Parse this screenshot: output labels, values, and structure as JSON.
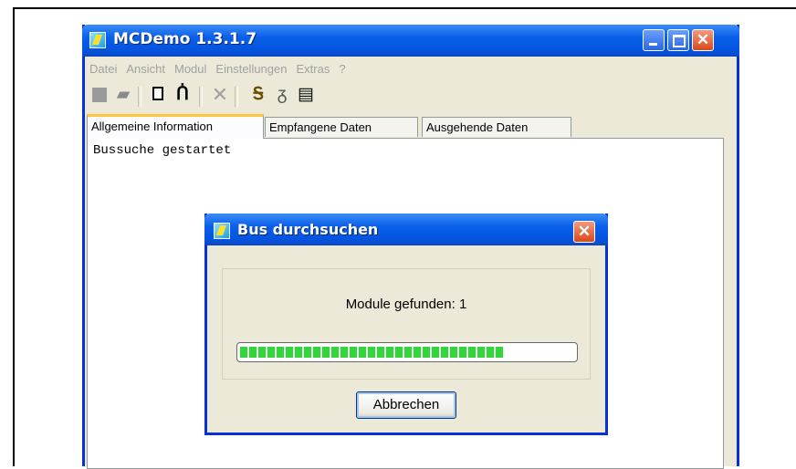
{
  "window": {
    "title": "MCDemo 1.3.1.7"
  },
  "menubar": {
    "items": [
      "Datei",
      "Ansicht",
      "Modul",
      "Einstellungen",
      "Extras",
      "?"
    ]
  },
  "toolbar": {
    "icons": [
      "stop-icon",
      "print-icon",
      "new-document-icon",
      "binoculars-icon",
      "delete-icon",
      "bus-search-icon",
      "connect-icon",
      "properties-icon"
    ]
  },
  "tabs": [
    {
      "label": "Allgemeine Information",
      "active": true
    },
    {
      "label": "Empfangene Daten",
      "active": false
    },
    {
      "label": "Ausgehende Daten",
      "active": false
    }
  ],
  "console": {
    "text": "Bussuche gestartet"
  },
  "dialog": {
    "title": "Bus durchsuchen",
    "status": "Module gefunden: 1",
    "progress_fraction": 0.78,
    "cancel_label": "Abbrechen"
  },
  "colors": {
    "titlebar": "#0a5fe8",
    "progress": "#2fd838",
    "window_bg": "#ece9d8",
    "tab_highlight": "#ffc83c"
  }
}
